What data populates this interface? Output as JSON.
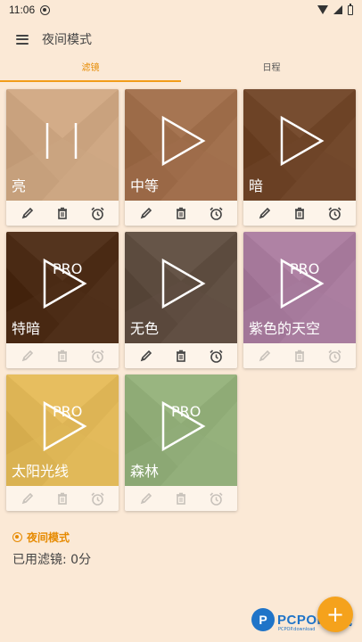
{
  "status": {
    "time": "11:06"
  },
  "app": {
    "title": "夜间模式"
  },
  "tabs": [
    {
      "label": "滤镜",
      "active": true
    },
    {
      "label": "日程",
      "active": false
    }
  ],
  "filters": [
    {
      "name": "亮",
      "color": "#c9a27e",
      "icon": "pause-icon",
      "pro": false,
      "enabled": true
    },
    {
      "name": "中等",
      "color": "#9c6b48",
      "icon": "play-icon",
      "pro": false,
      "enabled": true
    },
    {
      "name": "暗",
      "color": "#6d4326",
      "icon": "play-icon",
      "pro": false,
      "enabled": true
    },
    {
      "name": "特暗",
      "color": "#4a2a14",
      "icon": "play-pro-icon",
      "pro": true,
      "enabled": false
    },
    {
      "name": "无色",
      "color": "#5c4b3e",
      "icon": "play-icon",
      "pro": false,
      "enabled": true
    },
    {
      "name": "紫色的天空",
      "color": "#a5789a",
      "icon": "play-pro-icon",
      "pro": true,
      "enabled": false
    },
    {
      "name": "太阳光线",
      "color": "#ddb455",
      "icon": "play-pro-icon",
      "pro": true,
      "enabled": false
    },
    {
      "name": "森林",
      "color": "#8fab76",
      "icon": "play-pro-icon",
      "pro": true,
      "enabled": false
    }
  ],
  "pro_label": "PRO",
  "footer": {
    "title": "夜间模式",
    "used_filters": "已用滤镜: 0分"
  },
  "fab": {
    "icon": "add-icon",
    "label": "+"
  },
  "watermark": {
    "brand": "PCPOP",
    "cn": "下载",
    "sub": "PCPOP.download"
  }
}
